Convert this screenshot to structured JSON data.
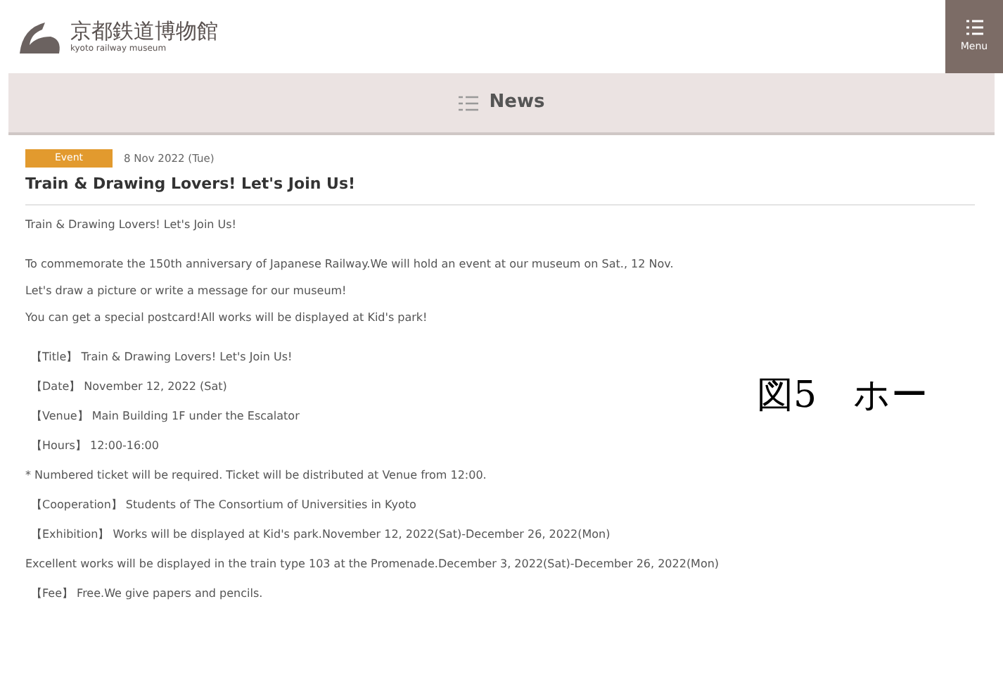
{
  "header": {
    "logo_title": "京都鉄道博物館",
    "logo_subtitle": "kyoto railway museum",
    "menu_button": {
      "label": "Menu"
    }
  },
  "section_bar": {
    "title": "News"
  },
  "article": {
    "badge": "Event",
    "date": "8 Nov 2022 (Tue)",
    "title": "Train & Drawing Lovers! Let's Join Us!",
    "intro": "Train & Drawing Lovers! Let's Join Us!",
    "paragraph": [
      "To commemorate the 150th anniversary of Japanese Railway.We will hold an event at our museum on Sat., 12 Nov.",
      "Let's draw a picture or write a message for our museum!",
      "You can get a special postcard!All works will be displayed at Kid's park!"
    ],
    "details": [
      {
        "kind": "field",
        "text": "【Title】 Train & Drawing Lovers! Let's Join Us!"
      },
      {
        "kind": "field",
        "text": "【Date】 November 12, 2022 (Sat)"
      },
      {
        "kind": "field",
        "text": "【Venue】 Main Building 1F under the Escalator"
      },
      {
        "kind": "field",
        "text": "【Hours】 12:00-16:00"
      },
      {
        "kind": "note",
        "text": "* Numbered ticket will be required. Ticket will be distributed at Venue from 12:00."
      },
      {
        "kind": "field",
        "text": "【Cooperation】 Students of The Consortium of Universities in Kyoto"
      },
      {
        "kind": "field",
        "text": "【Exhibition】 Works will be displayed at Kid's park.November 12, 2022(Sat)-December 26, 2022(Mon)"
      },
      {
        "kind": "note",
        "text": "Excellent works will be displayed in the train type 103 at the Promenade.December 3, 2022(Sat)-December 26, 2022(Mon)"
      },
      {
        "kind": "field",
        "text": "【Fee】 Free.We give papers and pencils."
      }
    ]
  },
  "caption": "図5　ホー"
}
